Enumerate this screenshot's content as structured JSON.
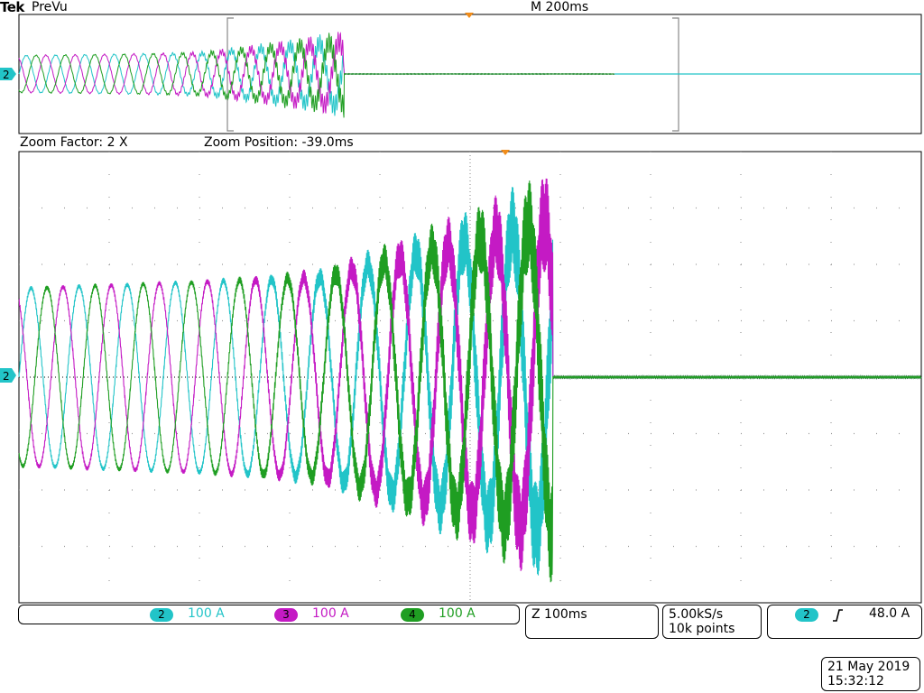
{
  "header": {
    "brand": "Tek",
    "mode": "PreVu",
    "timebase": "M 200ms",
    "zoom_factor": "Zoom Factor: 2 X",
    "zoom_position": "Zoom Position: -39.0ms"
  },
  "channels": [
    {
      "number": "2",
      "scale": "100 A",
      "color": "#22c4c8"
    },
    {
      "number": "3",
      "scale": "100 A",
      "color": "#c41ac4"
    },
    {
      "number": "4",
      "scale": "100 A",
      "color": "#1f9e22"
    }
  ],
  "zoom_timebase": "Z 100ms",
  "acquisition": {
    "sample_rate": "5.00kS/s",
    "record_length": "10k points"
  },
  "trigger": {
    "source": "2",
    "slope_icon": "rising-edge-icon",
    "level": "48.0 A"
  },
  "datetime": {
    "date": "21 May 2019",
    "time": "15:32:12"
  },
  "ground_marker": "2",
  "chart_data": {
    "type": "line",
    "title": "",
    "xlabel": "",
    "ylabel": "",
    "grid": true,
    "divisions": {
      "x": 10,
      "y": 8
    },
    "units": {
      "time_per_div_ms": 100,
      "amps_per_div": 100
    },
    "waveform_model": {
      "description": "three-phase sinusoidal currents, 120 degrees apart, growing ripple toward the end then collapsing to zero",
      "period_ms": 64,
      "amplitude_A_start": 157,
      "amplitude_A_peak": 280,
      "ripple_onset_ms": 400,
      "cutoff_ms": 710,
      "record_end_ms": 1000
    },
    "series": [
      {
        "name": "2",
        "color": "#22c4c8",
        "phase_deg": 0
      },
      {
        "name": "3",
        "color": "#c41ac4",
        "phase_deg": 120
      },
      {
        "name": "4",
        "color": "#1f9e22",
        "phase_deg": 240
      }
    ]
  }
}
